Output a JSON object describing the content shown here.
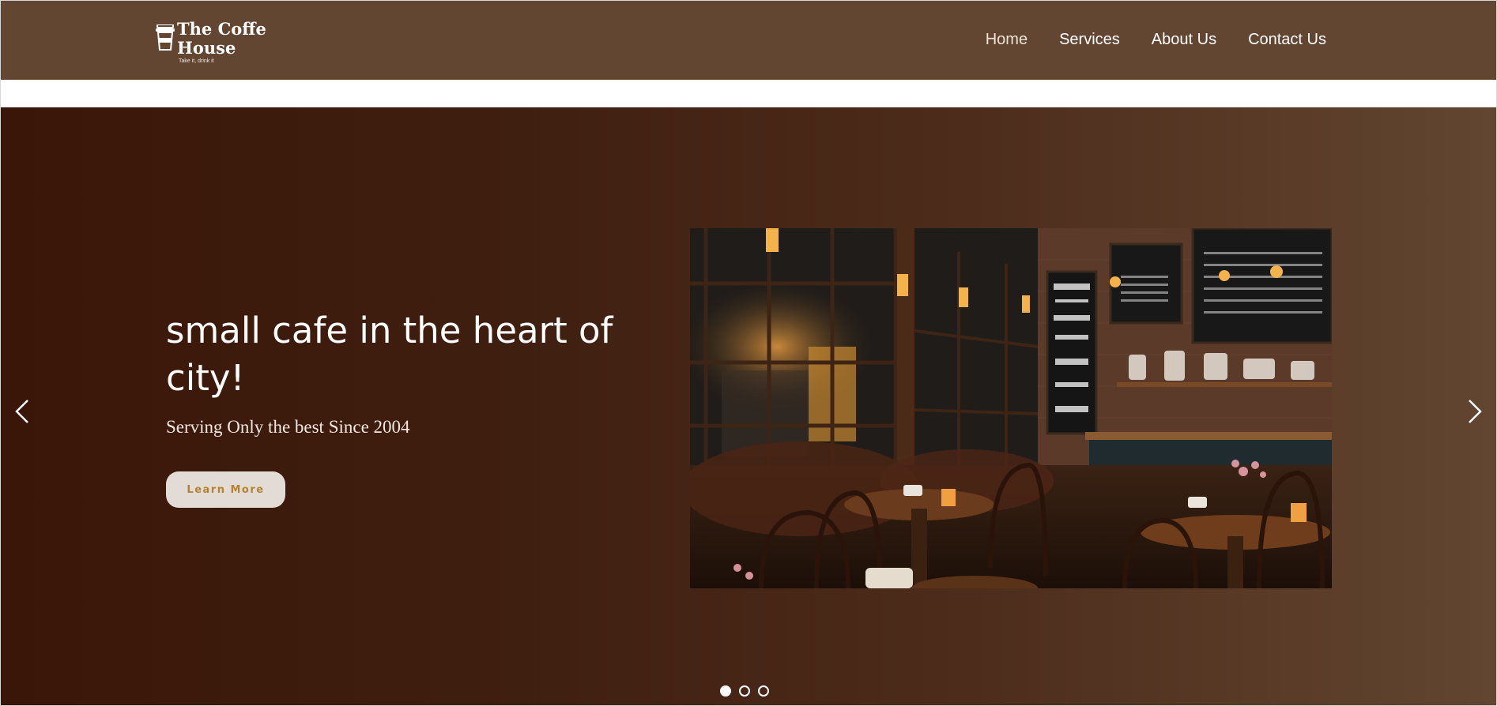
{
  "header": {
    "brand": {
      "title": "The Coffe\nHouse",
      "tagline": "Take it, drink it",
      "icon": "coffee-cup-icon"
    },
    "nav": {
      "home": "Home",
      "services": "Services",
      "about": "About Us",
      "contact": "Contact Us"
    }
  },
  "hero": {
    "headline": "small cafe in the heart of city!",
    "subline": "Serving Only the best Since 2004",
    "button_label": "Learn More",
    "image_icon": "cafe-interior-photo",
    "prev_icon": "chevron-left-icon",
    "next_icon": "chevron-right-icon",
    "slides_total": 3,
    "active_slide": 1
  },
  "colors": {
    "header_bg": "#624631",
    "hero_dark": "#3a1608",
    "hero_light": "#624631",
    "button_text": "#b5832c"
  }
}
